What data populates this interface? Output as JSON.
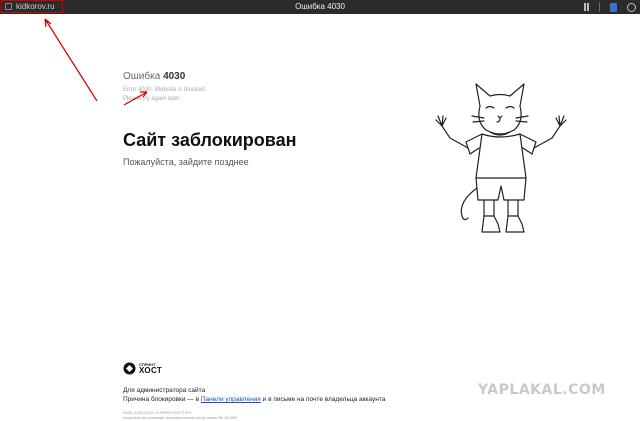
{
  "browser": {
    "url": "kidkorov.ru",
    "tab_title": "Ошибка 4030"
  },
  "error": {
    "code_prefix": "Ошибка",
    "code": "4030",
    "english_line1": "Error 4030. Website is blocked.",
    "english_line2": "Please try again later.",
    "headline": "Сайт заблокирован",
    "subtitle": "Пожалуйста, зайдите позднее"
  },
  "footer": {
    "logo_small": "СПРИНТ",
    "logo_big": "ХОСТ",
    "admin_title": "Для администратора сайта",
    "reason_prefix": "Причина блокировки — в",
    "reason_link": "Панели управления",
    "reason_suffix": "и в письме на почте владельца аккаунта",
    "copyright_line1": "2005–2023 ООО «СПРИНТХОСТ.РУ»",
    "copyright_line2": "Лицензия на оказание телематических услуг связи № 162992"
  },
  "watermark": "YAPLAKAL.COM",
  "colors": {
    "annotation": "#d40000",
    "link": "#1a4fb5"
  }
}
